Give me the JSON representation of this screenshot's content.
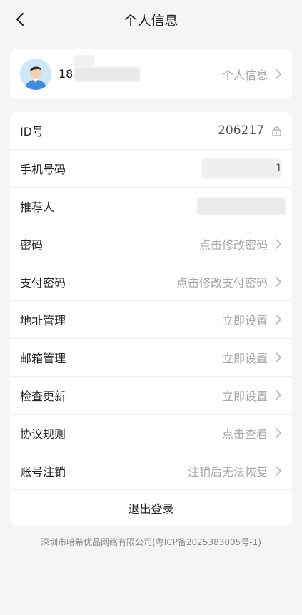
{
  "header": {
    "title": "个人信息"
  },
  "profile": {
    "name_prefix": "18",
    "right_label": "个人信息"
  },
  "rows": [
    {
      "label": "ID号",
      "value": "206217"
    },
    {
      "label": "手机号码",
      "value": "1"
    },
    {
      "label": "推荐人",
      "value": ""
    },
    {
      "label": "密码",
      "value": "点击修改密码"
    },
    {
      "label": "支付密码",
      "value": "点击修改支付密码"
    },
    {
      "label": "地址管理",
      "value": "立即设置"
    },
    {
      "label": "邮箱管理",
      "value": "立即设置"
    },
    {
      "label": "检查更新",
      "value": "立即设置"
    },
    {
      "label": "协议规则",
      "value": "点击查看"
    },
    {
      "label": "账号注销",
      "value": "注销后无法恢复"
    }
  ],
  "logout_label": "退出登录",
  "footer": "深圳市哈希优品网络有限公司(粤ICP备2025383005号-1)",
  "icons": {
    "back": "back-arrow-icon",
    "chevron": "chevron-right-icon",
    "lock": "lock-icon",
    "avatar": "default-avatar-icon"
  }
}
